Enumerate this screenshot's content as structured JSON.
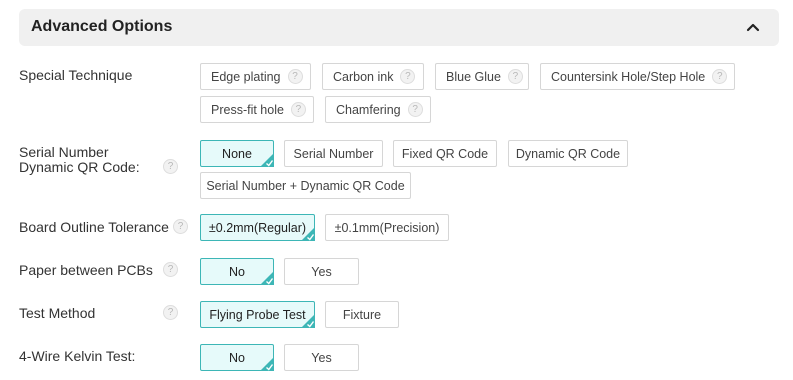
{
  "header": {
    "title": "Advanced Options"
  },
  "special_technique": {
    "label": "Special Technique",
    "options": [
      "Edge plating",
      "Carbon ink",
      "Blue Glue",
      "Countersink Hole/Step Hole",
      "Press-fit hole",
      "Chamfering"
    ]
  },
  "serial_number": {
    "label_line1": "Serial Number",
    "label_line2": "Dynamic QR Code:",
    "options": [
      "None",
      "Serial Number",
      "Fixed QR Code",
      "Dynamic QR Code",
      "Serial Number + Dynamic QR Code"
    ],
    "selected": "None"
  },
  "board_outline": {
    "label": "Board Outline Tolerance",
    "options": [
      "±0.2mm(Regular)",
      "±0.1mm(Precision)"
    ],
    "selected": "±0.2mm(Regular)"
  },
  "paper_between": {
    "label": "Paper between PCBs",
    "options": [
      "No",
      "Yes"
    ],
    "selected": "No"
  },
  "test_method": {
    "label": "Test Method",
    "options": [
      "Flying Probe Test",
      "Fixture"
    ],
    "selected": "Flying Probe Test"
  },
  "kelvin": {
    "label": "4-Wire Kelvin Test:",
    "options": [
      "No",
      "Yes"
    ],
    "selected": "No"
  },
  "help_glyph": "?",
  "colors": {
    "accent": "#3db6b6",
    "selected_bg": "#e6fafa",
    "header_bg": "#f0f0f0"
  },
  "icons": {
    "collapse": "chevron-up-icon",
    "help": "help-icon",
    "selected_mark": "check-corner-icon"
  }
}
